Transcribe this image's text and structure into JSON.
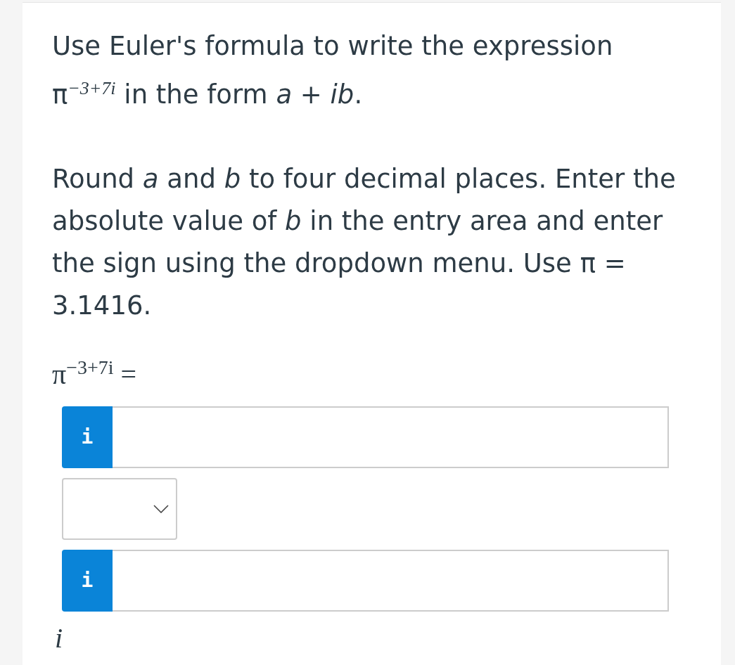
{
  "question": {
    "intro": "Use Euler's formula to write the expression π$^{−3+7i}$ in the form *a* + *ib*.",
    "instructions": "Round *a* and *b* to four decimal places. Enter the absolute value of *b* in the entry area and enter the sign using the dropdown menu. Use π = 3.1416."
  },
  "equation_lhs": "π$^{−3+7i}$ =",
  "answer": {
    "real_part": {
      "info": "i"
    },
    "sign_dropdown": {
      "expanded": false
    },
    "imaginary_part": {
      "info": "i"
    },
    "suffix": "i"
  }
}
